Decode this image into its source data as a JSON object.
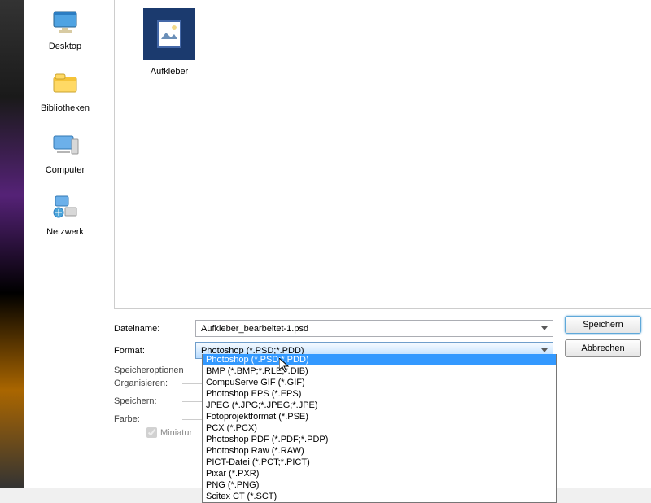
{
  "sidebar": {
    "items": [
      {
        "label": "Desktop",
        "icon": "desktop-icon"
      },
      {
        "label": "Bibliotheken",
        "icon": "libraries-icon"
      },
      {
        "label": "Computer",
        "icon": "computer-icon"
      },
      {
        "label": "Netzwerk",
        "icon": "network-icon"
      }
    ]
  },
  "files": {
    "items": [
      {
        "label": "Aufkleber"
      }
    ]
  },
  "form": {
    "filename_label": "Dateiname:",
    "filename_value": "Aufkleber_bearbeitet-1.psd",
    "format_label": "Format:",
    "format_value": "Photoshop (*.PSD;*.PDD)"
  },
  "buttons": {
    "save": "Speichern",
    "cancel": "Abbrechen"
  },
  "dropdown": {
    "options": [
      {
        "label": "Photoshop (*.PSD;*.PDD)",
        "highlighted": true
      },
      {
        "label": "BMP (*.BMP;*.RLE;*.DIB)"
      },
      {
        "label": "CompuServe GIF (*.GIF)"
      },
      {
        "label": "Photoshop EPS (*.EPS)"
      },
      {
        "label": "JPEG (*.JPG;*.JPEG;*.JPE)"
      },
      {
        "label": "Fotoprojektformat (*.PSE)"
      },
      {
        "label": "PCX (*.PCX)"
      },
      {
        "label": "Photoshop PDF (*.PDF;*.PDP)"
      },
      {
        "label": "Photoshop Raw (*.RAW)"
      },
      {
        "label": "PICT-Datei (*.PCT;*.PICT)"
      },
      {
        "label": "Pixar (*.PXR)"
      },
      {
        "label": "PNG (*.PNG)"
      },
      {
        "label": "Scitex CT (*.SCT)"
      }
    ]
  },
  "options": {
    "save_options_label": "Speicheroptionen",
    "organize_label": "Organisieren:",
    "save_label": "Speichern:",
    "color_label": "Farbe:",
    "thumbnail_label": "Miniatur",
    "thumbnail_checked": true
  }
}
